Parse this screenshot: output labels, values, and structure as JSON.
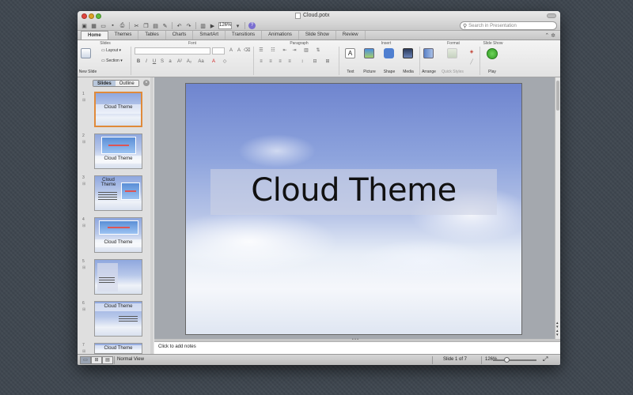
{
  "window": {
    "title": "Cloud.potx"
  },
  "toolbar": {
    "zoom": "126%"
  },
  "search": {
    "placeholder": "Search in Presentation"
  },
  "tabs": [
    "Home",
    "Themes",
    "Tables",
    "Charts",
    "SmartArt",
    "Transitions",
    "Animations",
    "Slide Show",
    "Review"
  ],
  "ribbon": {
    "groups": {
      "slides": "Slides",
      "font": "Font",
      "paragraph": "Paragraph",
      "insert": "Insert",
      "format": "Format",
      "slide_show": "Slide Show"
    },
    "new_slide": "New Slide",
    "layout": "Layout",
    "section": "Section",
    "insert_items": [
      "Text",
      "Picture",
      "Shape",
      "Media"
    ],
    "arrange": "Arrange",
    "quick_styles": "Quick Styles",
    "play": "Play"
  },
  "left_pane": {
    "segments": [
      "Slides",
      "Outline"
    ],
    "thumbnails": [
      {
        "num": "1",
        "title": "Cloud Theme"
      },
      {
        "num": "2",
        "title": "Cloud Theme"
      },
      {
        "num": "3",
        "title": "Cloud Theme"
      },
      {
        "num": "4",
        "title": "Cloud Theme"
      },
      {
        "num": "5",
        "title": ""
      },
      {
        "num": "6",
        "title": "Cloud Theme"
      },
      {
        "num": "7",
        "title": "Cloud Theme"
      }
    ]
  },
  "slide": {
    "title": "Cloud Theme"
  },
  "notes": {
    "placeholder": "Click to add notes"
  },
  "status": {
    "view": "Normal View",
    "slide_count": "Slide 1 of 7",
    "zoom": "126%",
    "zoom_level_percent": 126
  },
  "colors": {
    "accent_selection": "#e08a3a",
    "sky_top": "#6f85cf"
  }
}
